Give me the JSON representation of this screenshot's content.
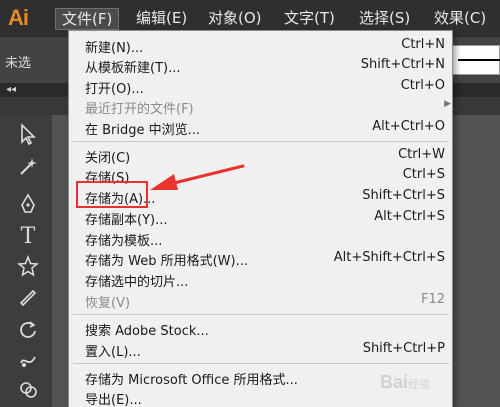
{
  "app": {
    "logo": "Ai"
  },
  "menubar": {
    "items": [
      {
        "label": "文件(F)"
      },
      {
        "label": "编辑(E)"
      },
      {
        "label": "对象(O)"
      },
      {
        "label": "文字(T)"
      },
      {
        "label": "选择(S)"
      },
      {
        "label": "效果(C)"
      }
    ]
  },
  "controlbar": {
    "label": "未选"
  },
  "panel": {
    "collapse_label": "◂◂"
  },
  "file_menu": {
    "items": [
      {
        "label": "新建(N)...",
        "shortcut": "Ctrl+N"
      },
      {
        "label": "从模板新建(T)...",
        "shortcut": "Shift+Ctrl+N"
      },
      {
        "label": "打开(O)...",
        "shortcut": "Ctrl+O"
      },
      {
        "label": "最近打开的文件(F)",
        "shortcut": ""
      },
      {
        "label": "在 Bridge 中浏览...",
        "shortcut": "Alt+Ctrl+O"
      },
      {
        "label": "关闭(C)",
        "shortcut": "Ctrl+W"
      },
      {
        "label": "存储(S)",
        "shortcut": "Ctrl+S"
      },
      {
        "label": "存储为(A)...",
        "shortcut": "Shift+Ctrl+S"
      },
      {
        "label": "存储副本(Y)...",
        "shortcut": "Alt+Ctrl+S"
      },
      {
        "label": "存储为模板...",
        "shortcut": ""
      },
      {
        "label": "存储为 Web 所用格式(W)...",
        "shortcut": "Alt+Shift+Ctrl+S"
      },
      {
        "label": "存储选中的切片...",
        "shortcut": ""
      },
      {
        "label": "恢复(V)",
        "shortcut": "F12"
      },
      {
        "label": "搜索 Adobe Stock...",
        "shortcut": ""
      },
      {
        "label": "置入(L)...",
        "shortcut": "Shift+Ctrl+P"
      },
      {
        "label": "存储为 Microsoft Office 所用格式...",
        "shortcut": ""
      },
      {
        "label": "导出(E)...",
        "shortcut": ""
      }
    ]
  },
  "colors": {
    "menubar": "#2f2f2f",
    "menu_bg": "#f0f0f0",
    "accent_logo": "#e48a2a",
    "annotation": "#e8332f"
  },
  "watermark": {
    "text": "Bai",
    "sub": "经验"
  }
}
